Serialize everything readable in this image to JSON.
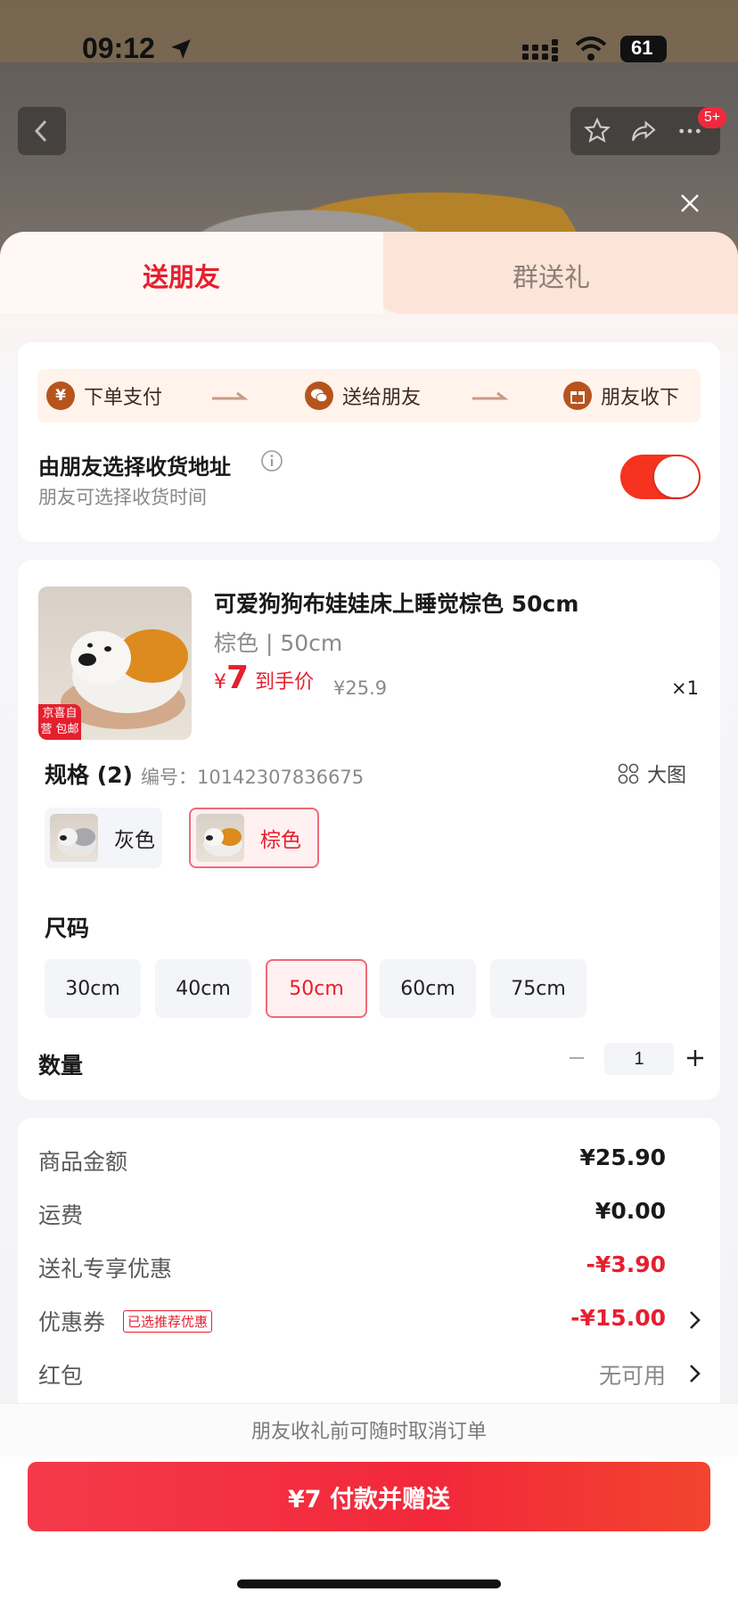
{
  "status_bar": {
    "time": "09:12",
    "battery": "61"
  },
  "topbar": {
    "badge": "5+"
  },
  "tabs": [
    {
      "label": "送朋友",
      "active": true
    },
    {
      "label": "群送礼",
      "active": false
    }
  ],
  "steps": [
    {
      "icon": "yen-icon",
      "glyph": "¥",
      "label": "下单支付"
    },
    {
      "icon": "wechat-icon",
      "glyph": "✉",
      "label": "送给朋友"
    },
    {
      "icon": "gift-icon",
      "glyph": "🎁",
      "label": "朋友收下"
    }
  ],
  "address": {
    "title": "由朋友选择收货地址",
    "subtitle": "朋友可选择收货时间",
    "toggle_on": true
  },
  "product": {
    "title": "可爱狗狗布娃娃床上睡觉棕色 50cm",
    "spec": "棕色 | 50cm",
    "price_symbol": "¥",
    "price": "7",
    "price_label": "到手价",
    "original_price": "¥25.9",
    "quantity_label": "×1",
    "thumb_tag": "京喜自营 包邮"
  },
  "spec": {
    "title": "规格 (2)",
    "code": "编号：10142307836675",
    "big_image_label": "大图",
    "colors": [
      {
        "label": "灰色",
        "selected": false
      },
      {
        "label": "棕色",
        "selected": true
      }
    ]
  },
  "size": {
    "title": "尺码",
    "options": [
      {
        "label": "30cm",
        "selected": false
      },
      {
        "label": "40cm",
        "selected": false
      },
      {
        "label": "50cm",
        "selected": true
      },
      {
        "label": "60cm",
        "selected": false
      },
      {
        "label": "75cm",
        "selected": false
      }
    ]
  },
  "quantity": {
    "title": "数量",
    "value": "1"
  },
  "fees": [
    {
      "label": "商品金额",
      "value": "¥25.90",
      "style": "normal"
    },
    {
      "label": "运费",
      "value": "¥0.00",
      "style": "normal"
    },
    {
      "label": "送礼专享优惠",
      "value": "-¥3.90",
      "style": "red"
    },
    {
      "label": "优惠券",
      "tag": "已选推荐优惠",
      "value": "-¥15.00",
      "style": "red",
      "chevron": true
    },
    {
      "label": "红包",
      "value": "无可用",
      "style": "grey",
      "chevron": true
    }
  ],
  "bottom": {
    "note": "朋友收礼前可随时取消订单",
    "pay_button": "¥7 付款并赠送"
  },
  "colors": {
    "accent": "#e5202f",
    "toggle": "#f5331f",
    "step_icon": "#b5551d"
  }
}
